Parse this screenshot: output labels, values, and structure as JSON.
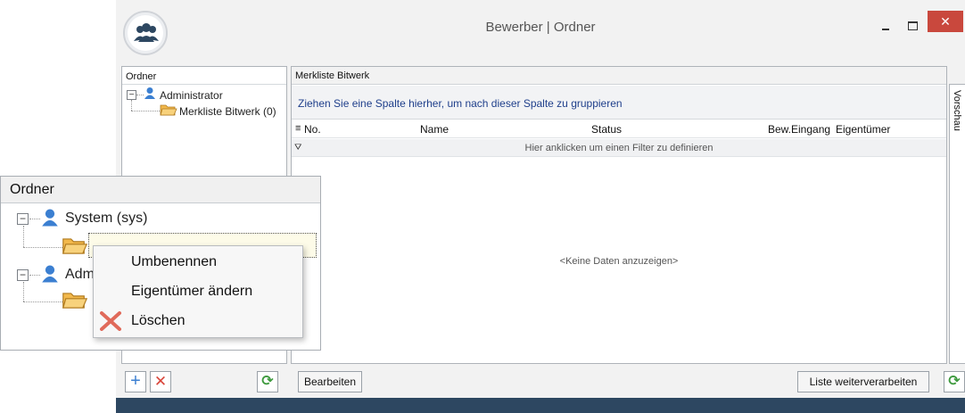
{
  "window": {
    "title": "Bewerber | Ordner",
    "close_glyph": "✕"
  },
  "left_panel": {
    "header": "Ordner",
    "tree": [
      {
        "label": "Administrator",
        "expander": "−"
      },
      {
        "label": "Merkliste Bitwerk (0)"
      }
    ]
  },
  "grid": {
    "title": "Merkliste Bitwerk",
    "group_hint": "Ziehen Sie eine Spalte hierher, um nach dieser Spalte zu gruppieren",
    "row_menu_glyph": "≡",
    "filter_glyph": "⛛",
    "columns": [
      "No.",
      "Name",
      "Status",
      "Bew.Eingang",
      "Eigentümer"
    ],
    "filter_hint": "Hier anklicken um einen Filter zu definieren",
    "empty": "<Keine Daten anzuzeigen>"
  },
  "preview_tab": "Vorschau",
  "bottom_bar": {
    "add_glyph": "+",
    "delete_glyph": "✕",
    "refresh_glyph": "⟳",
    "edit_button": "Bearbeiten",
    "process_button": "Liste weiterverarbeiten"
  },
  "zoom_tree": {
    "header": "Ordner",
    "nodes": [
      {
        "label": "System (sys)",
        "expander": "−"
      },
      {
        "label": "Adm",
        "expander": "−"
      }
    ]
  },
  "context_menu": {
    "items": [
      "Umbenennen",
      "Eigentümer ändern",
      "Löschen"
    ]
  },
  "colors": {
    "status_bar": "#2d4761",
    "close_button": "#c9483d",
    "user_icon": "#3b7fd1",
    "folder": "#f2b84b",
    "link_text": "#1f3f8b",
    "delete_red": "#d9453a"
  }
}
